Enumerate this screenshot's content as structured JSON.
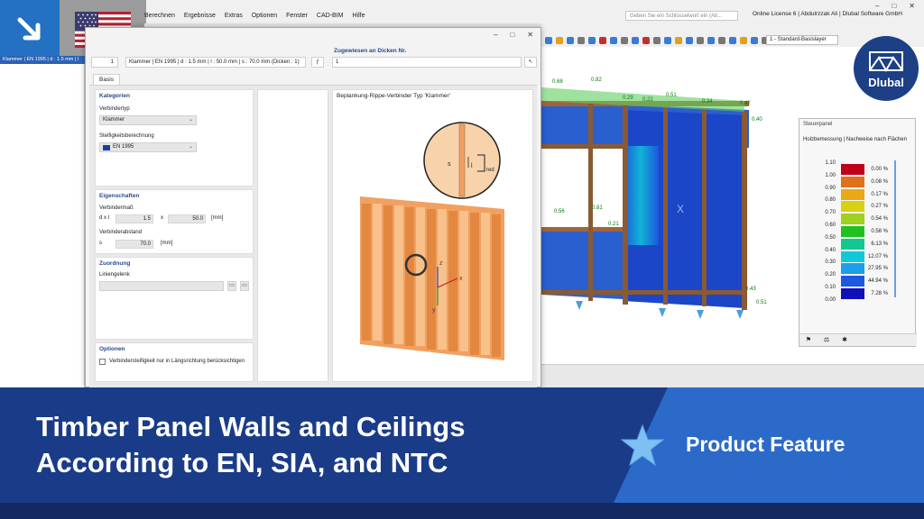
{
  "app": {
    "menu": [
      "Berechnen",
      "Ergebnisse",
      "Extras",
      "Optionen",
      "Fenster",
      "CAD-BIM",
      "Hilfe"
    ],
    "search_placeholder": "Geben Sie ein Schlüsselwort ein (Alt...",
    "license": "Online License 6 | Abdulrzzak Ali | Dlubal Software GmbH",
    "layer_select": "1 - Standard-Basislayer",
    "left_strip_text": "Klammer | EN 1995 | d : 1.5 mm | l"
  },
  "dialog": {
    "number": "1",
    "name": "Klammer | EN 1995 | d : 1.5 mm | l : 50.0 mm | s : 70.0 mm (Dicken : 1)",
    "assigned_label": "Zugewiesen an Dicken Nr.",
    "assigned_value": "1",
    "tab": "Basis",
    "kategorien": {
      "title": "Kategorien",
      "verbindertyp_label": "Verbindertyp",
      "verbindertyp_value": "Klammer",
      "steifigkeit_label": "Steifigkeitsberechnung",
      "steifigkeit_value": "EN 1995"
    },
    "eigenschaften": {
      "title": "Eigenschaften",
      "verbindermass_label": "Verbindermaß",
      "dxl_label": "d x l",
      "d_value": "1.5",
      "x_sep": "x",
      "l_value": "50.0",
      "unit_mm": "[mm]",
      "abstand_label": "Verbinderabstand",
      "s_label": "s",
      "s_value": "70.0",
      "unit_mm2": "[mm]"
    },
    "zuordnung": {
      "title": "Zuordnung",
      "liniengelenk_label": "Liniengelenk"
    },
    "optionen": {
      "title": "Optionen",
      "checkbox_label": "Verbindersteifigkeit nur in Längsrichtung berücksichtigen"
    },
    "preview_title": "Beplankung-Rippe-Verbinder Typ 'Klammer'",
    "preview_labels": {
      "s": "s",
      "l": "l",
      "red": "red",
      "x": "x",
      "y": "y",
      "z": "z"
    }
  },
  "view3d": {
    "labels": [
      "0.68",
      "0.82",
      "0.29",
      "0.22",
      "0.51",
      "0.34",
      "0.42",
      "0.40",
      "0.56",
      "0.81",
      "0.21",
      "0.43",
      "0.51"
    ],
    "panel_x": "X"
  },
  "control_panel": {
    "title": "Steuerpanel",
    "subtitle": "Holzbemessung | Nachweise nach Flächen",
    "legend": [
      {
        "value": "1.10",
        "color": "#c0001a",
        "pct": "0.00 %"
      },
      {
        "value": "1.00",
        "color": "#e0701a",
        "pct": "0.08 %"
      },
      {
        "value": "0.90",
        "color": "#e8a818",
        "pct": "0.17 %"
      },
      {
        "value": "0.80",
        "color": "#d8d012",
        "pct": "0.27 %"
      },
      {
        "value": "0.70",
        "color": "#a0d020",
        "pct": "0.54 %"
      },
      {
        "value": "0.60",
        "color": "#20c020",
        "pct": "0.58 %"
      },
      {
        "value": "0.50",
        "color": "#10c890",
        "pct": "6.13 %"
      },
      {
        "value": "0.40",
        "color": "#10c8d8",
        "pct": "12.07 %"
      },
      {
        "value": "0.30",
        "color": "#1c9ee8",
        "pct": "27.95 %"
      },
      {
        "value": "0.20",
        "color": "#1c58e0",
        "pct": "44.94 %"
      },
      {
        "value": "0.10",
        "color": "#1010b8",
        "pct": "7.28 %"
      },
      {
        "value": "0.00",
        "color": "",
        "pct": ""
      }
    ]
  },
  "logo": {
    "text": "Dlubal"
  },
  "banner": {
    "headline_line1": "Timber Panel Walls and Ceilings",
    "headline_line2": "According to EN, SIA, and NTC",
    "badge": "Product Feature"
  },
  "colors": {
    "banner_dark": "#1a3c88",
    "banner_light": "#2c6ac9",
    "accent_star": "#7ec0f4"
  }
}
